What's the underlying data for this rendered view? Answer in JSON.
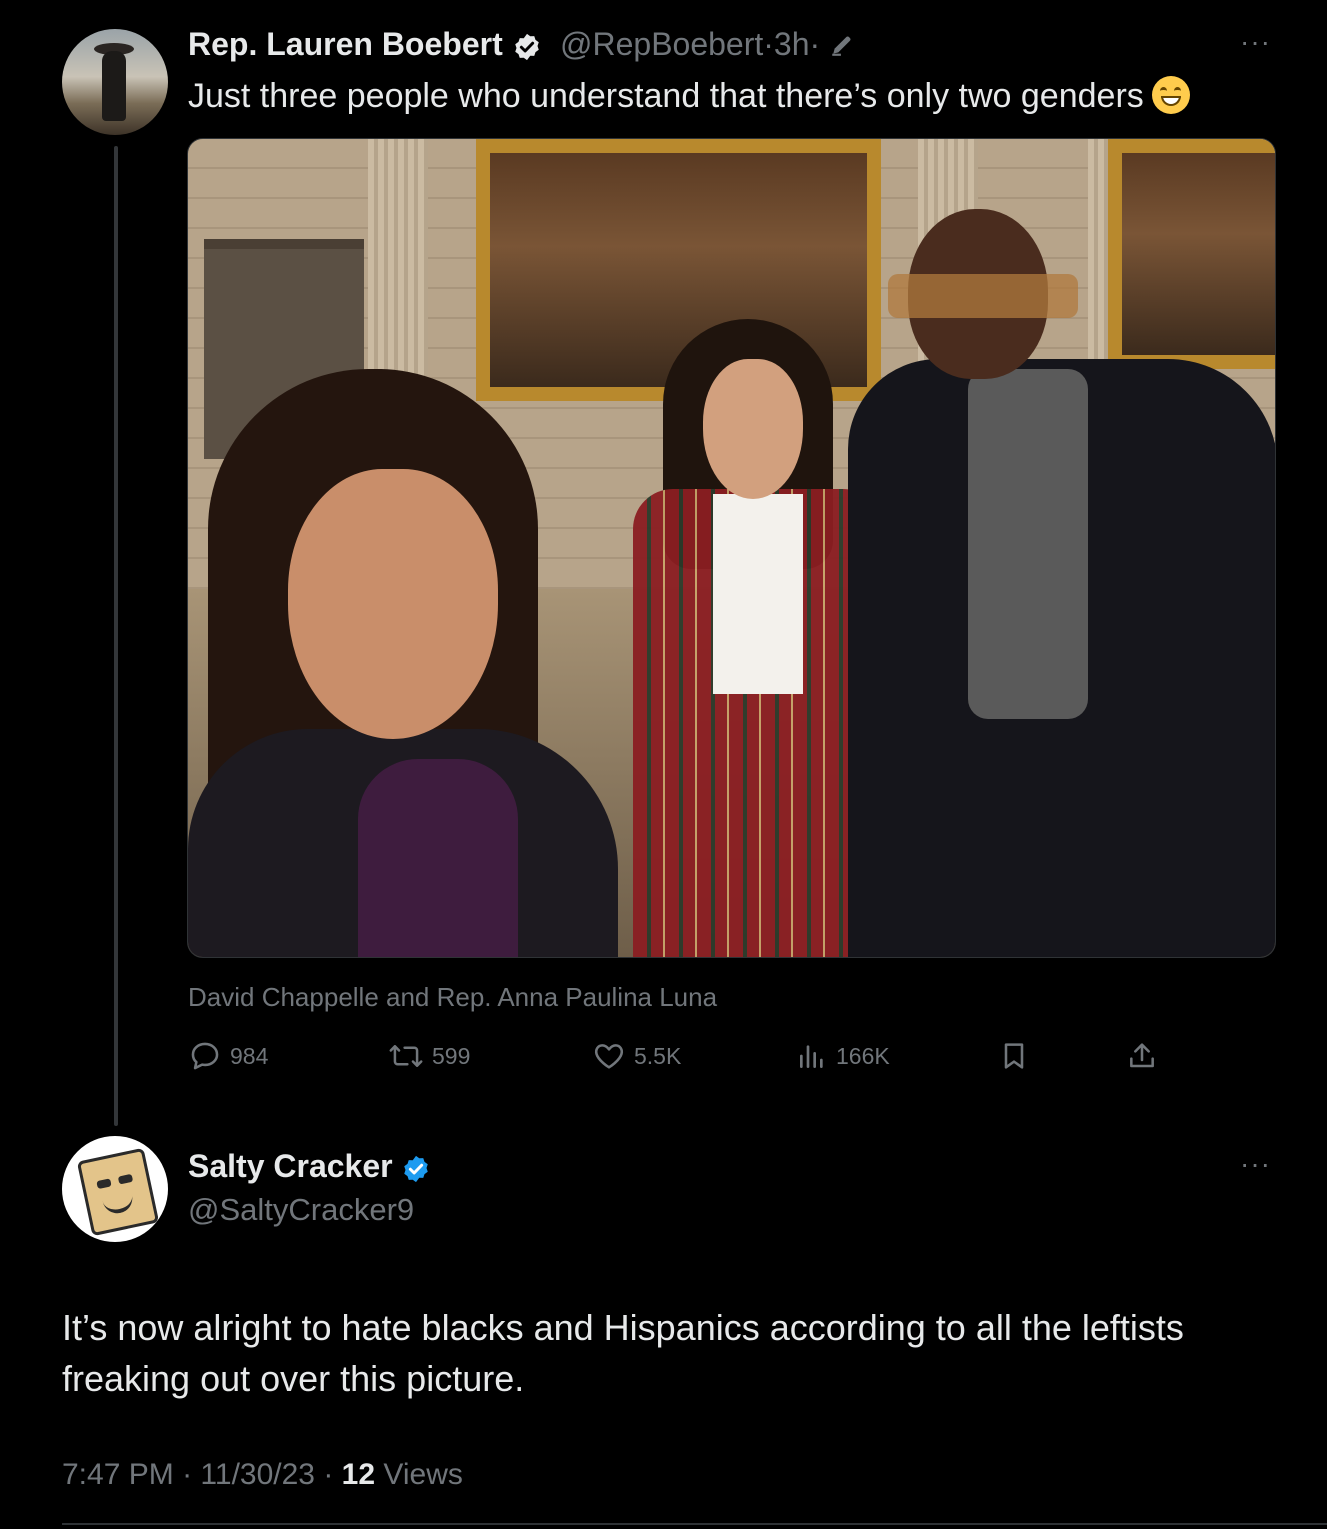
{
  "colors": {
    "background": "#000000",
    "text": "#e7e9ea",
    "muted": "#71767b",
    "verified": "#1d9bf0"
  },
  "tweet1": {
    "display_name": "Rep. Lauren Boebert",
    "handle": "@RepBoebert",
    "separator1": "·",
    "age": "3h",
    "separator2": "·",
    "more": "···",
    "text": "Just three people who understand that there’s only two genders",
    "emoji": "grinning-face-emoji",
    "image_caption": "David Chappelle and Rep. Anna Paulina Luna",
    "actions": {
      "replies": "984",
      "reposts": "599",
      "likes": "5.5K",
      "views": "166K"
    }
  },
  "tweet2": {
    "display_name": "Salty Cracker",
    "handle": "@SaltyCracker9",
    "more": "···",
    "text": "It’s now alright to hate blacks and Hispanics according to all the leftists freaking out over this picture.",
    "time": "7:47 PM",
    "sep1": "·",
    "date": "11/30/23",
    "sep2": "·",
    "views_count": "12",
    "views_label": "Views"
  }
}
